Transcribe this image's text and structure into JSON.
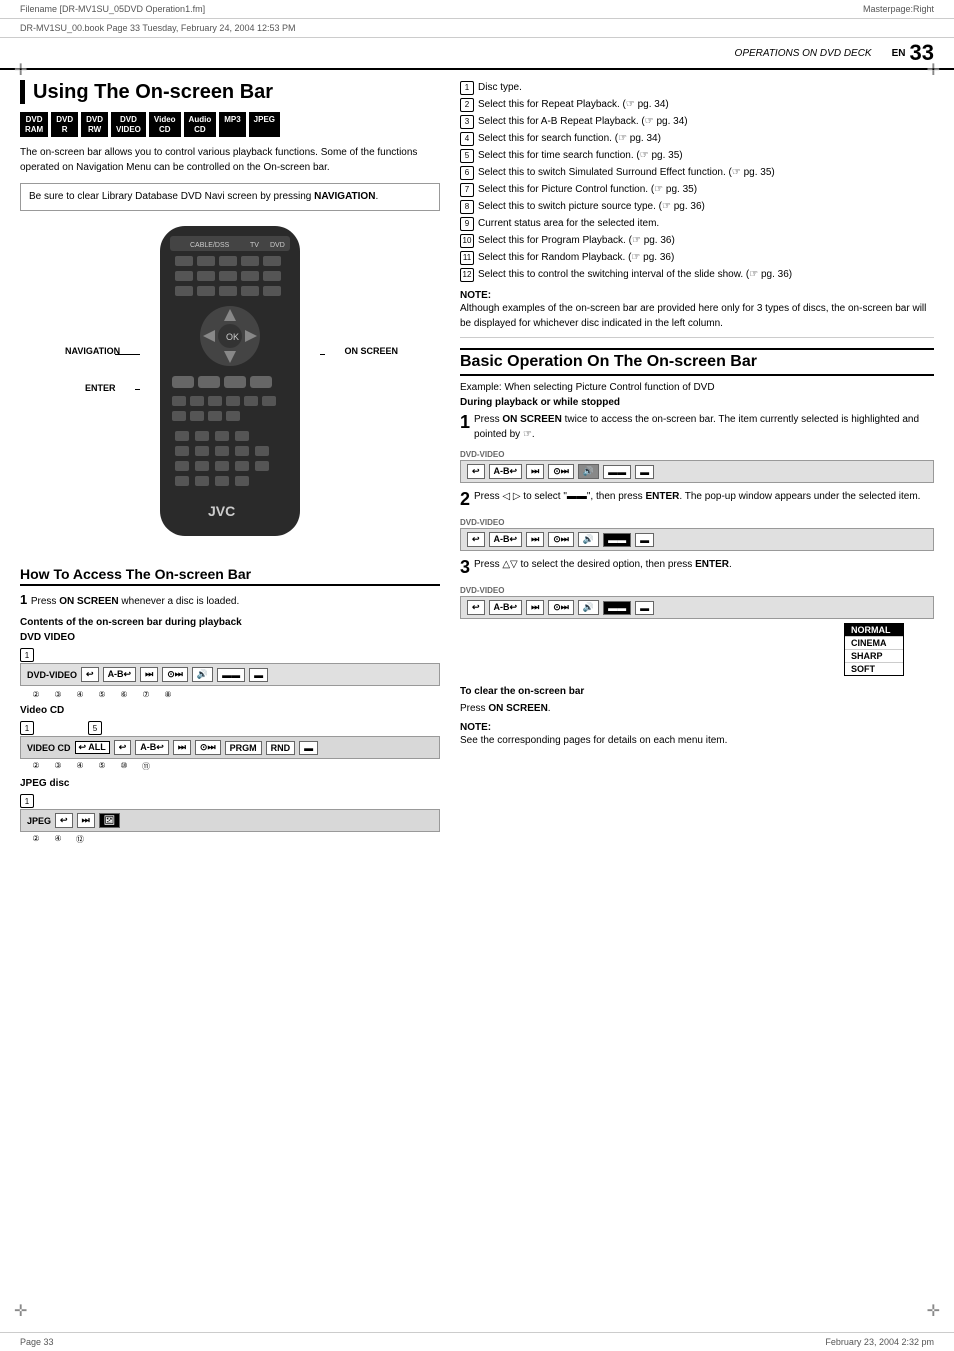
{
  "header": {
    "filename": "Filename [DR-MV1SU_05DVD Operation1.fm]",
    "book_ref": "DR-MV1SU_00.book  Page 33  Tuesday, February 24, 2004  12:53 PM",
    "masterpage": "Masterpage:Right"
  },
  "page": {
    "number": "33",
    "en_label": "EN",
    "operations_title": "OPERATIONS ON DVD DECK"
  },
  "left": {
    "section_title": "Using The On-screen Bar",
    "disc_icons": [
      {
        "label": "DVD\nRAM",
        "class": "dvd-ram"
      },
      {
        "label": "DVD\nR",
        "class": "dvd-r"
      },
      {
        "label": "DVD\nRW",
        "class": "dvd-rw"
      },
      {
        "label": "DVD\nVIDEO",
        "class": "dvd-video"
      },
      {
        "label": "Video\nCD",
        "class": "video-cd"
      },
      {
        "label": "Audio\nCD",
        "class": "audio-cd"
      },
      {
        "label": "MP3",
        "class": "mp3"
      },
      {
        "label": "JPEG",
        "class": "jpeg"
      }
    ],
    "intro": "The on-screen bar allows you to control various playback functions. Some of the functions operated on Navigation Menu can be controlled on the On-screen bar.",
    "note_box": "Be sure to clear Library Database DVD Navi screen by pressing NAVIGATION.",
    "remote_labels": {
      "navigation": "NAVIGATION",
      "enter": "ENTER",
      "on_screen": "ON SCREEN"
    },
    "how_to_title": "How To Access The On-screen Bar",
    "step1_text": "Press ON SCREEN whenever a disc is loaded.",
    "contents_title": "Contents of the on-screen bar during playback",
    "dvd_video_label": "DVD VIDEO",
    "dvd_video_bar": {
      "label": "DVD-VIDEO",
      "items": [
        "↩",
        "A-B↩",
        "⏭",
        "⊙⏭",
        "🔊",
        "▬",
        "▬"
      ]
    },
    "num_row_dvd": [
      "②",
      "③",
      "④",
      "⑤",
      "⑥",
      "⑦",
      "⑧"
    ],
    "video_cd_label": "Video CD",
    "video_cd_bar": {
      "label": "VIDEO CD",
      "items": [
        "↩",
        "A-B↩",
        "⏭",
        "⊙⏭",
        "PRGM",
        "RND",
        "▬"
      ]
    },
    "num_row_vcd": [
      "②",
      "③",
      "④",
      "⑤",
      "⑩",
      "⑪"
    ],
    "jpeg_label": "JPEG disc",
    "jpeg_bar": {
      "label": "JPEG",
      "items": [
        "↩",
        "⏭",
        "🖼"
      ]
    },
    "num_row_jpeg": [
      "②",
      "④",
      "⑫"
    ]
  },
  "right": {
    "numbered_items": [
      {
        "num": "1",
        "text": "Disc type."
      },
      {
        "num": "2",
        "text": "Select this for Repeat Playback. (☞ pg. 34)"
      },
      {
        "num": "3",
        "text": "Select this for A-B Repeat Playback. (☞ pg. 34)"
      },
      {
        "num": "4",
        "text": "Select this for search function. (☞ pg. 34)"
      },
      {
        "num": "5",
        "text": "Select this for time search function. (☞ pg. 35)"
      },
      {
        "num": "6",
        "text": "Select this to switch Simulated Surround Effect function. (☞ pg. 35)"
      },
      {
        "num": "7",
        "text": "Select this for Picture Control function. (☞ pg. 35)"
      },
      {
        "num": "8",
        "text": "Select this to switch picture source type. (☞ pg. 36)"
      },
      {
        "num": "9",
        "text": "Current status area for the selected item."
      },
      {
        "num": "10",
        "text": "Select this for Program Playback. (☞ pg. 36)"
      },
      {
        "num": "11",
        "text": "Select this for Random Playback. (☞ pg. 36)"
      },
      {
        "num": "12",
        "text": "Select this to control the switching interval of the slide show. (☞ pg. 36)"
      }
    ],
    "note_label": "NOTE:",
    "note_text": "Although examples of the on-screen bar are provided here only for 3 types of discs, the on-screen bar will be displayed for whichever disc indicated in the left column.",
    "basic_title": "Basic Operation On The On-screen Bar",
    "example_text": "Example: When selecting Picture Control function of DVD",
    "during_playback": "During playback or while stopped",
    "step1": {
      "num": "1",
      "text": "Press ON SCREEN twice to access the on-screen bar. The item currently selected is highlighted and pointed by ☞."
    },
    "step2": {
      "num": "2",
      "text": "Press ◁ ▷ to select \"▬\", then press ENTER. The pop-up window appears under the selected item."
    },
    "step3": {
      "num": "3",
      "text": "Press △▽ to select the desired option, then press ENTER."
    },
    "bar1_label": "DVD-VIDEO",
    "bar2_label": "DVD-VIDEO",
    "bar3_label": "DVD-VIDEO",
    "popup_items": [
      "NORMAL",
      "CINEMA",
      "SHARP",
      "SOFT"
    ],
    "popup_selected": "NORMAL",
    "to_clear": "To clear the on-screen bar",
    "press_on_screen": "Press ON SCREEN.",
    "note2_label": "NOTE:",
    "note2_text": "See the corresponding pages for details on each menu item."
  },
  "footer": {
    "page_left": "Page 33",
    "date_right": "February 23, 2004 2:32 pm"
  }
}
